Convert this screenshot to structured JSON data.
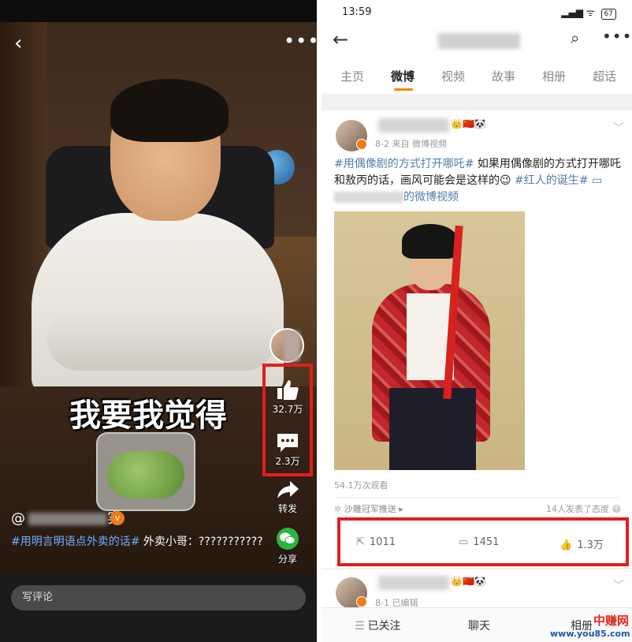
{
  "left": {
    "subtitle": "我要我觉得",
    "back_icon": "back-arrow-icon",
    "more_icon": "more-dots-icon",
    "actions": [
      {
        "icon": "thumbs-up-icon",
        "label": "32.7万"
      },
      {
        "icon": "comment-icon",
        "label": "2.3万"
      },
      {
        "icon": "share-icon",
        "label": "转发"
      },
      {
        "icon": "wechat-icon",
        "label": "分享"
      }
    ],
    "username_prefix": "@",
    "username_suffix": "实",
    "desc_tag": "#用明言明语点外卖的话#",
    "desc_text": " 外卖小哥：???????????",
    "comment_placeholder": "写评论",
    "highlight_color": "#e31d1d"
  },
  "right": {
    "status": {
      "time": "13:59",
      "battery": "67"
    },
    "tabs": [
      "主页",
      "微博",
      "视频",
      "故事",
      "相册",
      "超话"
    ],
    "active_tab": "微博",
    "post": {
      "meta": "8-2  来自 微博视频",
      "text_tag1": "#用偶像剧的方式打开哪吒#",
      "text_body": " 如果用偶像剧的方式打开哪吒和敖丙的话，画风可能会是这样的",
      "text_tag2": " #红人的诞生#",
      "video_link": "的微博视频",
      "views": "54.1万次观看",
      "push_label": "沙雕冠军推送",
      "reactions": "14人发表了态度",
      "reposts": "1011",
      "comments": "1451",
      "likes": "1.3万"
    },
    "post2": {
      "meta": "8-1  已编辑"
    },
    "bottom": {
      "follow": "已关注",
      "chat": "聊天",
      "extra": "相册"
    },
    "watermark": {
      "title": "中赚网",
      "url": "www.you85.com"
    }
  }
}
